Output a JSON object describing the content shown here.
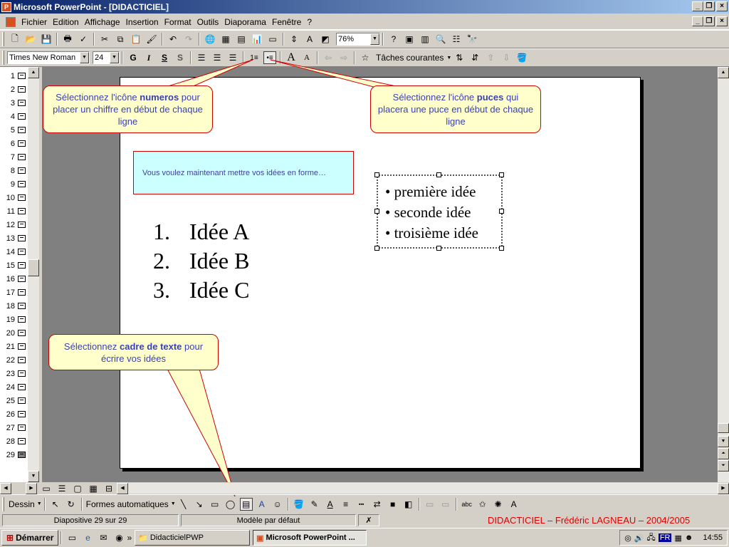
{
  "window": {
    "title": "Microsoft PowerPoint - [DIDACTICIEL]",
    "app_icon": "powerpoint-icon"
  },
  "menu": [
    "Fichier",
    "Edition",
    "Affichage",
    "Insertion",
    "Format",
    "Outils",
    "Diaporama",
    "Fenêtre",
    "?"
  ],
  "standard_toolbar": {
    "zoom": "76%"
  },
  "format_toolbar": {
    "font": "Times New Roman",
    "size": "24",
    "bold": "G",
    "italic": "I",
    "underline": "S",
    "shadow": "S",
    "tasks": "Tâches courantes"
  },
  "outline": {
    "slides": [
      "1",
      "2",
      "3",
      "4",
      "5",
      "6",
      "7",
      "8",
      "9",
      "10",
      "11",
      "12",
      "13",
      "14",
      "15",
      "16",
      "17",
      "18",
      "19",
      "20",
      "21",
      "22",
      "23",
      "24",
      "25",
      "26",
      "27",
      "28",
      "29"
    ]
  },
  "slide": {
    "callout_numeros": {
      "pre": "Sélectionnez l'icône ",
      "bold": "numeros",
      "post": " pour placer un chiffre en début de chaque ligne"
    },
    "callout_puces": {
      "pre": "Sélectionnez l'icône ",
      "bold": "puces",
      "post": " qui placera une puce en début de chaque ligne"
    },
    "callout_cadre": {
      "pre": "Sélectionnez ",
      "bold": "cadre de texte",
      "post": " pour écrire vos idées"
    },
    "note": "Vous voulez maintenant mettre vos idées en forme…",
    "numbered": [
      {
        "num": "1.",
        "text": "Idée A"
      },
      {
        "num": "2.",
        "text": "Idée B"
      },
      {
        "num": "3.",
        "text": "Idée C"
      }
    ],
    "bullets": [
      "• première idée",
      "• seconde idée",
      "• troisième idée"
    ]
  },
  "drawing_toolbar": {
    "dessin": "Dessin",
    "autoshapes": "Formes automatiques"
  },
  "status": {
    "slide": "Diapositive 29 sur 29",
    "design": "Modèle par défaut",
    "credit": "DIDACTICIEL – Frédéric LAGNEAU – 2004/2005"
  },
  "taskbar": {
    "start": "Démarrer",
    "tasks": [
      "DidacticielPWP",
      "Microsoft PowerPoint ..."
    ],
    "lang": "FR",
    "clock": "14:55"
  }
}
